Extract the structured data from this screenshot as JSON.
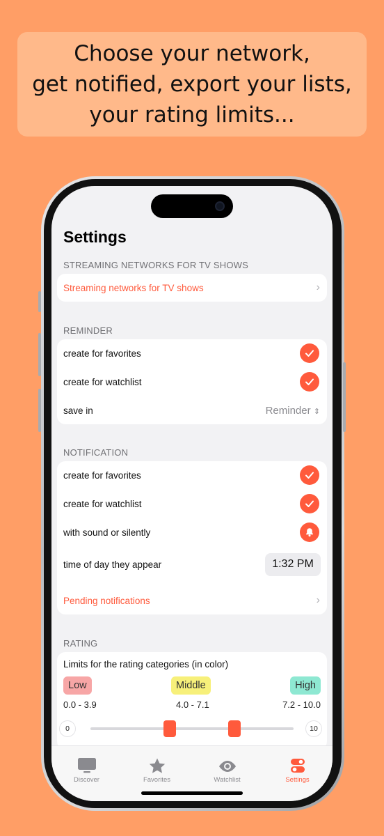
{
  "banner": {
    "line1": "Choose your network,",
    "line2": "get notified, export your lists,",
    "line3": "your rating limits..."
  },
  "page": {
    "title": "Settings"
  },
  "streaming": {
    "header": "STREAMING NETWORKS FOR TV SHOWS",
    "link": "Streaming networks for TV shows"
  },
  "reminder": {
    "header": "REMINDER",
    "favorites": "create for favorites",
    "watchlist": "create for watchlist",
    "save_in": "save in",
    "save_in_value": "Reminder",
    "favorites_checked": true,
    "watchlist_checked": true
  },
  "notification": {
    "header": "NOTIFICATION",
    "favorites": "create for favorites",
    "watchlist": "create for watchlist",
    "sound": "with sound or silently",
    "time_label": "time of day they appear",
    "time_value": "1:32 PM",
    "pending": "Pending notifications"
  },
  "rating": {
    "header": "RATING",
    "title": "Limits for the rating categories (in color)",
    "low": "Low",
    "middle": "Middle",
    "high": "High",
    "low_range": "0.0 - 3.9",
    "middle_range": "4.0 - 7.1",
    "high_range": "7.2 - 10.0",
    "slider_min": "0",
    "slider_max": "10",
    "lower_limit": 3.9,
    "upper_limit": 7.1,
    "colors": {
      "low": "#F7A6A6",
      "middle": "#F7F07A",
      "high": "#8EE8D2",
      "accent": "#FF5A3C"
    }
  },
  "tabs": [
    {
      "label": "Discover",
      "icon": "monitor-icon"
    },
    {
      "label": "Favorites",
      "icon": "star-icon"
    },
    {
      "label": "Watchlist",
      "icon": "eye-icon"
    },
    {
      "label": "Settings",
      "icon": "toggles-icon"
    }
  ]
}
